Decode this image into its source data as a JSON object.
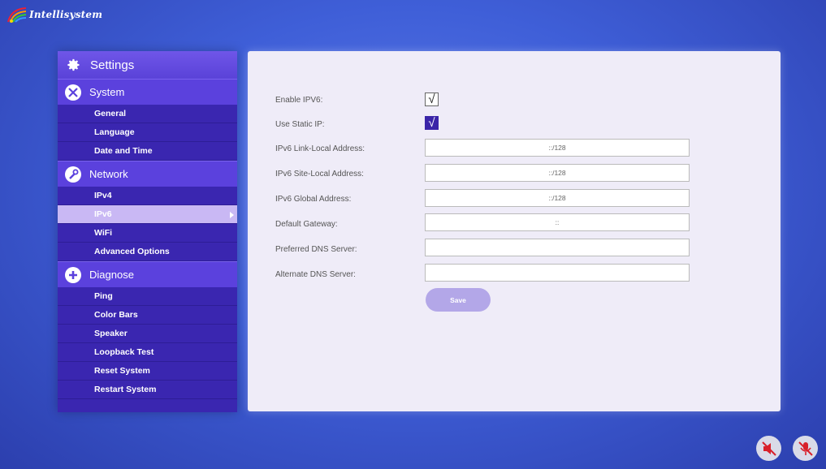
{
  "brand": {
    "name": "Intellisystem"
  },
  "sidebar": {
    "title": "Settings",
    "sections": [
      {
        "label": "System",
        "items": [
          "General",
          "Language",
          "Date and Time"
        ]
      },
      {
        "label": "Network",
        "items": [
          "IPv4",
          "IPv6",
          "WiFi",
          "Advanced Options"
        ]
      },
      {
        "label": "Diagnose",
        "items": [
          "Ping",
          "Color Bars",
          "Speaker",
          "Loopback Test",
          "Reset System",
          "Restart System"
        ]
      }
    ],
    "selected": "IPv6"
  },
  "form": {
    "enable_ipv6": {
      "label": "Enable IPV6:",
      "checked": true
    },
    "use_static_ip": {
      "label": "Use Static IP:",
      "checked": true
    },
    "link_local": {
      "label": "IPv6 Link-Local Address:",
      "value": "::/128"
    },
    "site_local": {
      "label": "IPv6 Site-Local Address:",
      "value": "::/128"
    },
    "global": {
      "label": "IPv6 Global Address:",
      "value": "::/128"
    },
    "gateway": {
      "label": "Default Gateway:",
      "value": "::"
    },
    "preferred_dns": {
      "label": "Preferred DNS Server:",
      "value": ""
    },
    "alternate_dns": {
      "label": "Alternate DNS Server:",
      "value": ""
    },
    "save_label": "Save",
    "check_glyph": "√"
  },
  "colors": {
    "accent": "#5b41dd",
    "sidebar_bg": "#3a26b0",
    "selected_bg": "#c9b8f4",
    "mute_red": "#d8202a"
  },
  "icons": [
    "settings-gear-icon",
    "system-tools-icon",
    "network-wrench-icon",
    "diagnose-plus-icon",
    "speaker-muted-icon",
    "microphone-muted-icon"
  ]
}
